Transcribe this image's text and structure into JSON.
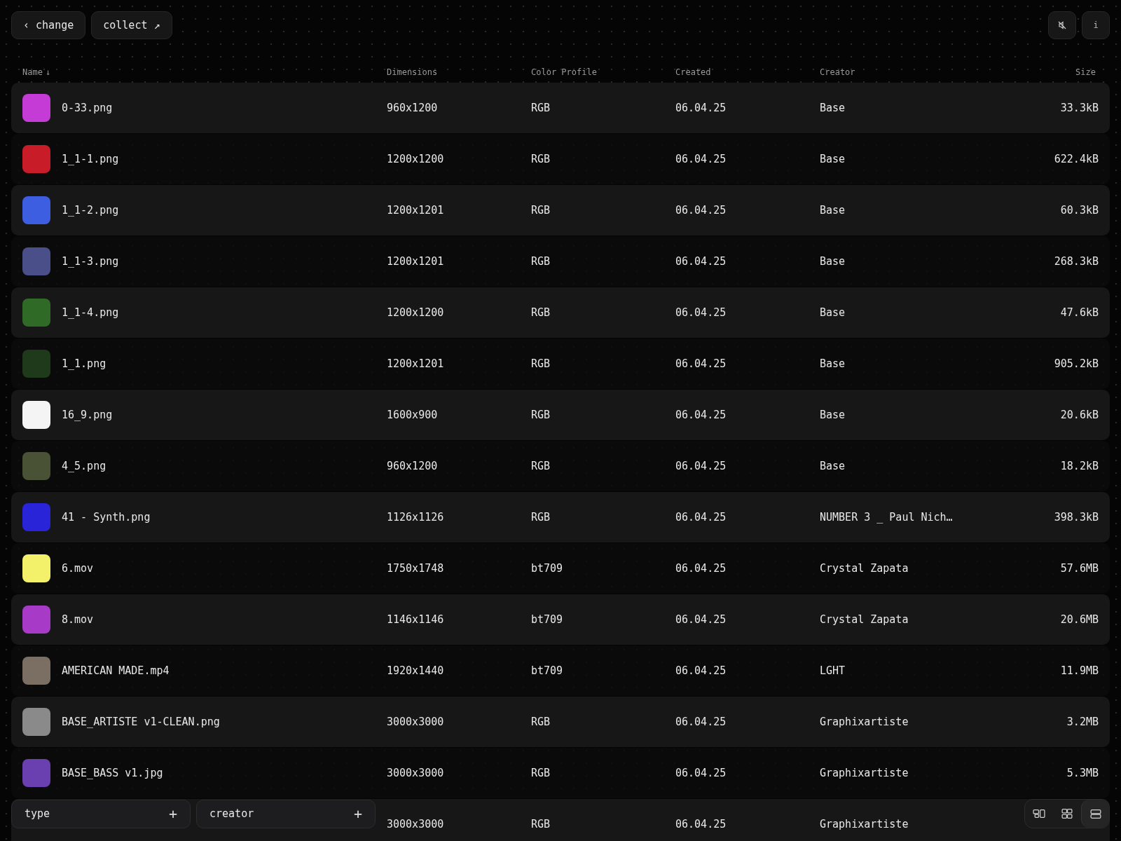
{
  "toolbar": {
    "back": {
      "icon": "‹",
      "label": "change"
    },
    "collect": {
      "label": "collect",
      "icon": "↗"
    },
    "info": "i"
  },
  "table": {
    "columns": [
      {
        "label": "Name",
        "sort": "↓"
      },
      {
        "label": "Dimensions"
      },
      {
        "label": "Color Profile"
      },
      {
        "label": "Created"
      },
      {
        "label": "Creator"
      },
      {
        "label": "Size"
      }
    ],
    "rows": [
      {
        "name": "0-33.png",
        "color": "#c43bd6",
        "dimensions": "960x1200",
        "profile": "RGB",
        "created": "06.04.25",
        "creator": "Base",
        "size": "33.3kB"
      },
      {
        "name": "1_1-1.png",
        "color": "#c81c28",
        "dimensions": "1200x1200",
        "profile": "RGB",
        "created": "06.04.25",
        "creator": "Base",
        "size": "622.4kB"
      },
      {
        "name": "1_1-2.png",
        "color": "#3d5ee0",
        "dimensions": "1200x1201",
        "profile": "RGB",
        "created": "06.04.25",
        "creator": "Base",
        "size": "60.3kB"
      },
      {
        "name": "1_1-3.png",
        "color": "#4a4f8a",
        "dimensions": "1200x1201",
        "profile": "RGB",
        "created": "06.04.25",
        "creator": "Base",
        "size": "268.3kB"
      },
      {
        "name": "1_1-4.png",
        "color": "#2f6a26",
        "dimensions": "1200x1200",
        "profile": "RGB",
        "created": "06.04.25",
        "creator": "Base",
        "size": "47.6kB"
      },
      {
        "name": "1_1.png",
        "color": "#1f3a1a",
        "dimensions": "1200x1201",
        "profile": "RGB",
        "created": "06.04.25",
        "creator": "Base",
        "size": "905.2kB"
      },
      {
        "name": "16_9.png",
        "color": "#f4f4f4",
        "dimensions": "1600x900",
        "profile": "RGB",
        "created": "06.04.25",
        "creator": "Base",
        "size": "20.6kB"
      },
      {
        "name": "4_5.png",
        "color": "#4a5236",
        "dimensions": "960x1200",
        "profile": "RGB",
        "created": "06.04.25",
        "creator": "Base",
        "size": "18.2kB"
      },
      {
        "name": "41 - Synth.png",
        "color": "#2a24d8",
        "dimensions": "1126x1126",
        "profile": "RGB",
        "created": "06.04.25",
        "creator": "NUMBER 3 _ Paul Nich…",
        "size": "398.3kB"
      },
      {
        "name": "6.mov",
        "color": "#f3f06a",
        "dimensions": "1750x1748",
        "profile": "bt709",
        "created": "06.04.25",
        "creator": "Crystal Zapata",
        "size": "57.6MB"
      },
      {
        "name": "8.mov",
        "color": "#a83ac8",
        "dimensions": "1146x1146",
        "profile": "bt709",
        "created": "06.04.25",
        "creator": "Crystal Zapata",
        "size": "20.6MB"
      },
      {
        "name": "AMERICAN MADE.mp4",
        "color": "#7a6f62",
        "dimensions": "1920x1440",
        "profile": "bt709",
        "created": "06.04.25",
        "creator": "LGHT",
        "size": "11.9MB"
      },
      {
        "name": "BASE_ARTISTE v1-CLEAN.png",
        "color": "#8a8a8a",
        "dimensions": "3000x3000",
        "profile": "RGB",
        "created": "06.04.25",
        "creator": "Graphixartiste",
        "size": "3.2MB"
      },
      {
        "name": "BASE_BASS v1.jpg",
        "color": "#6a3fb0",
        "dimensions": "3000x3000",
        "profile": "RGB",
        "created": "06.04.25",
        "creator": "Graphixartiste",
        "size": "5.3MB"
      },
      {
        "dimensions": "3000x3000",
        "profile": "RGB",
        "created": "06.04.25",
        "creator": "Graphixartiste"
      }
    ]
  },
  "filters": [
    {
      "label": "type",
      "icon": "+"
    },
    {
      "label": "creator",
      "icon": "+"
    }
  ],
  "views": [
    {
      "kind": "split",
      "selected": false
    },
    {
      "kind": "grid",
      "selected": false
    },
    {
      "kind": "list",
      "selected": true
    }
  ]
}
